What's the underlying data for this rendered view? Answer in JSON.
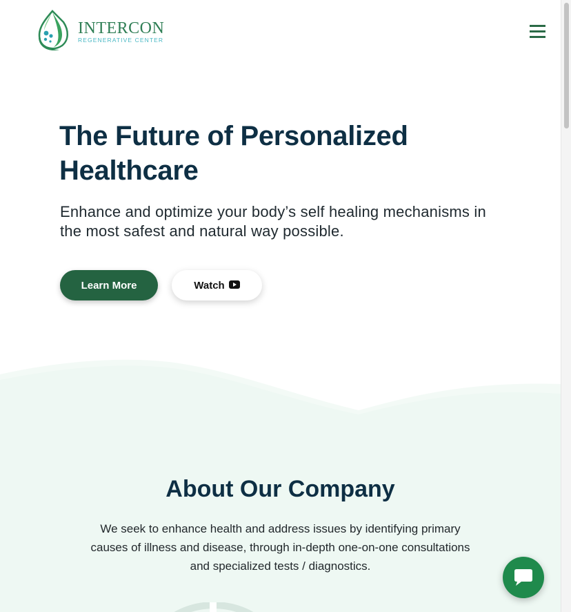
{
  "header": {
    "brand_name": "INTERCON",
    "brand_tagline": "REGENERATIVE CENTER",
    "menu_icon": "hamburger-menu-icon"
  },
  "hero": {
    "title": "The Future of Personalized Healthcare",
    "subtitle": "Enhance and optimize your body’s self healing mechanisms in the most safest and natural way possible.",
    "primary_button": "Learn More",
    "secondary_button": "Watch",
    "secondary_icon": "youtube-play-icon"
  },
  "about": {
    "title": "About Our Company",
    "text": "We seek to enhance health and address issues by identifying primary causes of illness and disease, through in-depth one-on-one consultations and specialized tests / diagnostics."
  },
  "chat": {
    "icon": "chat-bubble-icon"
  },
  "colors": {
    "brand_green": "#246341",
    "heading_navy": "#0e2f44",
    "about_bg": "#eef8f3",
    "chat_green": "#1f8a4c"
  }
}
